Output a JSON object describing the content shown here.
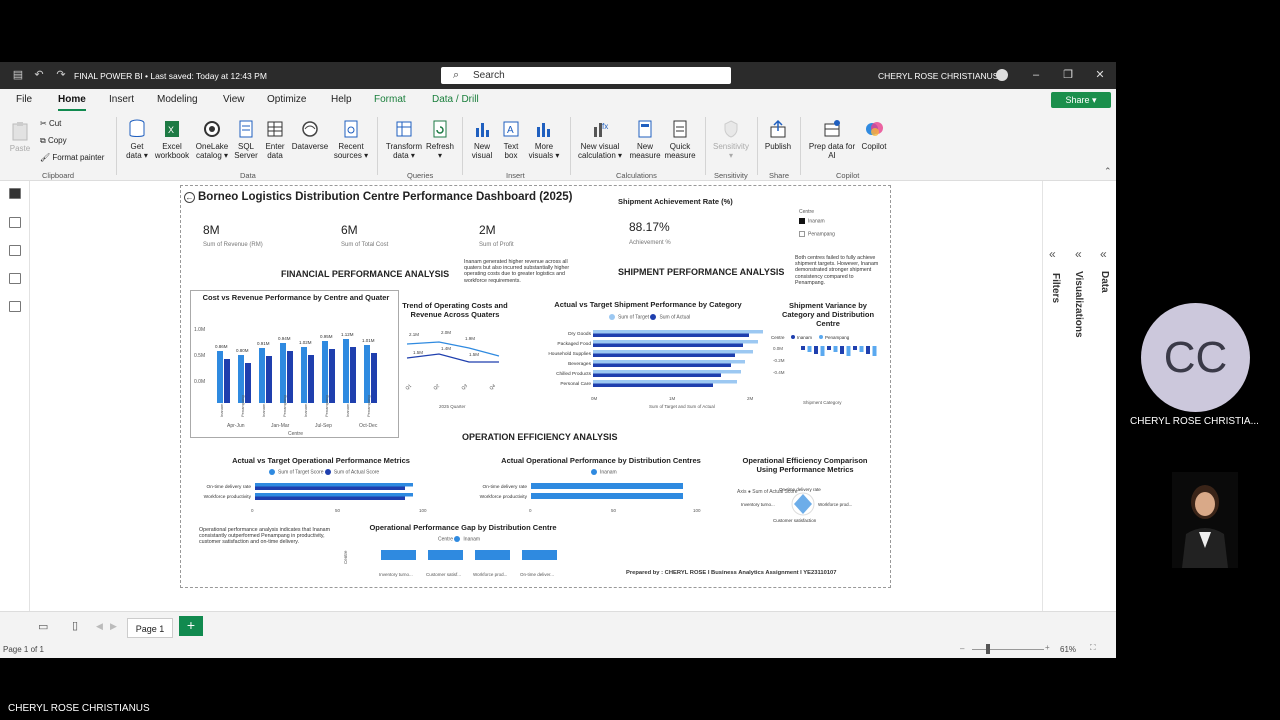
{
  "window": {
    "file_title": "FINAL POWER BI • Last saved: Today at 12:43 PM",
    "search_placeholder": "Search",
    "user_name": "CHERYL ROSE CHRISTIANUS"
  },
  "tabs": [
    "File",
    "Home",
    "Insert",
    "Modeling",
    "View",
    "Optimize",
    "Help",
    "Format",
    "Data / Drill"
  ],
  "active_tab": "Home",
  "share_label": "Share",
  "ribbon": {
    "clipboard": {
      "paste": "Paste",
      "cut": "Cut",
      "copy": "Copy",
      "format_painter": "Format painter",
      "group": "Clipboard"
    },
    "data": {
      "get_data": [
        "Get",
        "data"
      ],
      "excel": [
        "Excel",
        "workbook"
      ],
      "onelake": [
        "OneLake",
        "catalog"
      ],
      "sql": [
        "SQL",
        "Server"
      ],
      "enter": [
        "Enter",
        "data"
      ],
      "dataverse": [
        "Dataverse",
        ""
      ],
      "recent": [
        "Recent",
        "sources"
      ],
      "group": "Data"
    },
    "queries": {
      "transform": [
        "Transform",
        "data"
      ],
      "refresh": [
        "Refresh",
        ""
      ],
      "group": "Queries"
    },
    "insert": {
      "new_visual": [
        "New",
        "visual"
      ],
      "text_box": [
        "Text",
        "box"
      ],
      "more_visuals": [
        "More",
        "visuals"
      ],
      "group": "Insert"
    },
    "calculations": {
      "new_visual_calc": [
        "New visual",
        "calculation"
      ],
      "new_measure": [
        "New",
        "measure"
      ],
      "quick_measure": [
        "Quick",
        "measure"
      ],
      "group": "Calculations"
    },
    "sensitivity": {
      "label": "Sensitivity",
      "group": "Sensitivity"
    },
    "share": {
      "publish": "Publish",
      "group": "Share"
    },
    "copilot": {
      "prep": [
        "Prep data for",
        "AI"
      ],
      "copilot": [
        "Copilot",
        ""
      ],
      "group": "Copilot"
    }
  },
  "report": {
    "title": "Borneo Logistics Distribution Centre Performance Dashboard (2025)",
    "kpis": [
      {
        "value": "8M",
        "label": "Sum of Revenue (RM)"
      },
      {
        "value": "6M",
        "label": "Sum of Total Cost"
      },
      {
        "value": "2M",
        "label": "Sum of Profit"
      },
      {
        "value": "88.17%",
        "label": "Achievement %"
      }
    ],
    "shipment_rate_title": "Shipment Achievement Rate (%)",
    "legend_title": "Centre",
    "legend_items": [
      "Inanam",
      "Penampang"
    ],
    "centre_note": "Both centres failed to fully achieve shipment targets. However, Inanam demonstrated stronger shipment consistency compared to Penampang.",
    "financial_section": "FINANCIAL PERFORMANCE ANALYSIS",
    "financial_note": "Inanam generated higher revenue across all quaters but also incurred substantially higher operating costs due to greater logistics and workforce requirements.",
    "shipment_section": "SHIPMENT PERFORMANCE ANALYSIS",
    "operation_section": "OPERATION EFFICIENCY ANALYSIS",
    "cost_revenue_title": "Cost vs Revenue Performance by Centre and Quater",
    "cost_revenue_xaxis": "Centre",
    "cost_revenue_quarters": [
      "Apr-Jun",
      "Jan-Mar",
      "Jul-Sep",
      "Oct-Dec"
    ],
    "cost_revenue_bar_labels": [
      "0.86M",
      "0.80M",
      "0.91M",
      "0.94M",
      "1.02M",
      "0.95M",
      "1.12M",
      "1.01M"
    ],
    "cost_revenue_yticks": [
      "1.0M",
      "0.5M",
      "0.0M"
    ],
    "trend_title": "Trend of Operating Costs and Revenue Across Quaters",
    "trend_xaxis": "2025 Quarter",
    "trend_ticks": [
      "Q1",
      "Q2",
      "Q3",
      "Q4"
    ],
    "trend_labels": [
      "2.1M",
      "2.0M",
      "1.9M",
      "1.5M",
      "1.4M",
      "1.5M"
    ],
    "actual_target_title": "Actual vs Target Shipment Performance by Category",
    "actual_target_legend": [
      "Sum of Target",
      "Sum of Actual"
    ],
    "shipment_categories": [
      "Dry Goods",
      "Packaged Food",
      "Household Supplies",
      "Beverages",
      "Chilled Products",
      "Personal Care"
    ],
    "shipment_xticks": [
      "0M",
      "1M",
      "2M",
      "3M"
    ],
    "shipment_xlabel": "Sum of Target and Sum of Actual",
    "variance_title": "Shipment Variance by Category and Distribution Centre",
    "variance_legend": [
      "Inanam",
      "Penampang"
    ],
    "variance_yticks": [
      "0.0M",
      "-0.2M",
      "-0.4M"
    ],
    "variance_xlabel": "Shipment Category",
    "op_actual_target_title": "Actual vs Target Operational Performance Metrics",
    "op_actual_target_legend": [
      "Sum of Target Score",
      "Sum of Actual Score"
    ],
    "op_metrics": [
      "On-time delivery rate",
      "Workforce productivity"
    ],
    "op_xticks": [
      "0",
      "50",
      "100"
    ],
    "op_note": "Operational performance analysis indicates that Inanam consistantly outperformed Penampang in productivity, customer satisfaction and on-time delivery.",
    "actual_op_title": "Actual Operational Performance by Distribution Centres",
    "gap_title": "Operational Performance Gap by Distribution Centre",
    "gap_categories": [
      "Inventory turno...",
      "Customer satisf...",
      "Workforce prod...",
      "On-time deliver..."
    ],
    "gap_ylabel": "Centre",
    "gap_legend": [
      "Inanam"
    ],
    "efficiency_title": "Operational Efficiency Comparison Using Performance Metrics",
    "radar_labels": [
      "On-time delivery rate",
      "Workforce prod...",
      "Inventory turno...",
      "Customer satisfaction"
    ],
    "radar_legend": [
      "Axis",
      "Sum of Actual Score"
    ],
    "prepared_by": "Prepared by : CHERYL ROSE I Business Analytics Assignment I YE23110107"
  },
  "right_panes": [
    "Filters",
    "Visualizations",
    "Data"
  ],
  "page_tab": "Page 1",
  "status": {
    "page_info": "Page 1 of 1",
    "zoom": "61%"
  },
  "presenter": {
    "initials": "CC",
    "name": "CHERYL ROSE CHRISTIA...",
    "footer": "CHERYL ROSE CHRISTIANUS"
  },
  "colors": {
    "accent_green": "#118a4f",
    "bar_dark": "#1f3fae",
    "bar_light": "#2f8ae0",
    "inanam": "#1f3fae",
    "penampang": "#5aa9f0"
  }
}
